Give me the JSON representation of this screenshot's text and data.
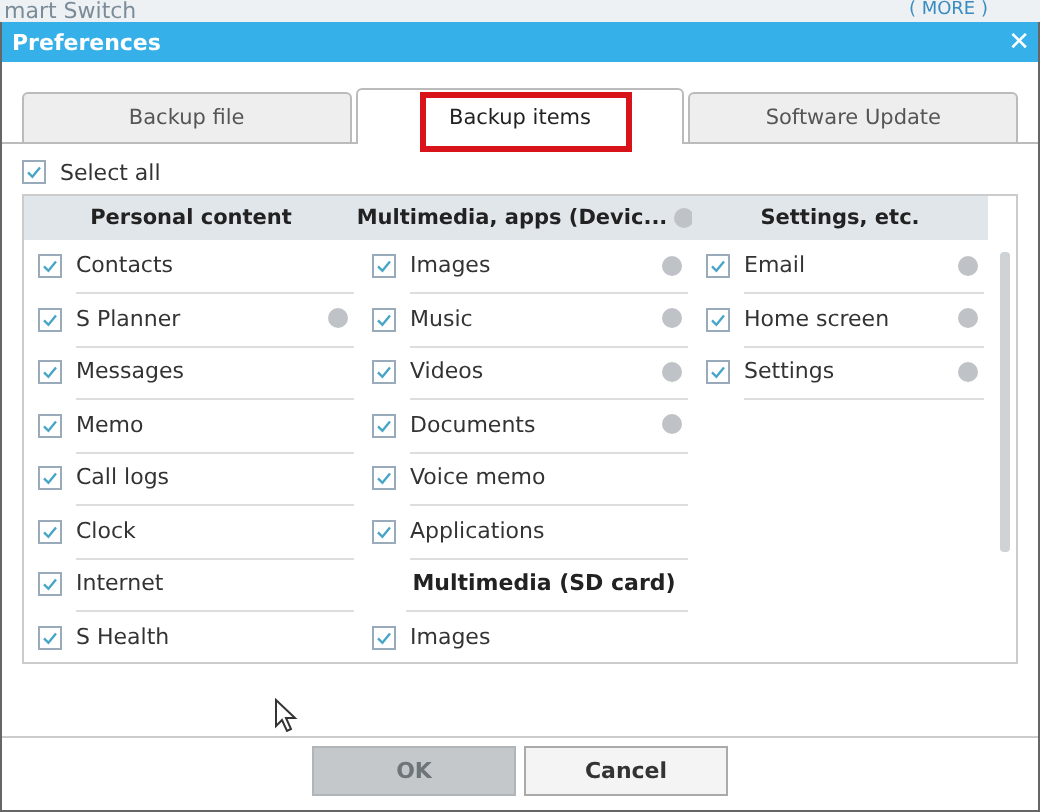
{
  "background_app": {
    "title": "mart Switch",
    "more_button": "( MORE )"
  },
  "window": {
    "title": "Preferences",
    "close": "✕"
  },
  "tabs": [
    {
      "label": "Backup file",
      "selected": false,
      "highlighted": false
    },
    {
      "label": "Backup items",
      "selected": true,
      "highlighted": true
    },
    {
      "label": "Software Update",
      "selected": false,
      "highlighted": false
    }
  ],
  "select_all": {
    "label": "Select all",
    "checked": true
  },
  "columns": [
    {
      "heading": "Personal content",
      "info": false,
      "items": [
        {
          "kind": "item",
          "label": "Contacts",
          "checked": true,
          "info": false
        },
        {
          "kind": "item",
          "label": "S Planner",
          "checked": true,
          "info": true
        },
        {
          "kind": "item",
          "label": "Messages",
          "checked": true,
          "info": false
        },
        {
          "kind": "item",
          "label": "Memo",
          "checked": true,
          "info": false
        },
        {
          "kind": "item",
          "label": "Call logs",
          "checked": true,
          "info": false
        },
        {
          "kind": "item",
          "label": "Clock",
          "checked": true,
          "info": false
        },
        {
          "kind": "item",
          "label": "Internet",
          "checked": true,
          "info": false
        },
        {
          "kind": "item",
          "label": "S Health",
          "checked": true,
          "info": false
        }
      ]
    },
    {
      "heading": "Multimedia, apps (Devic...",
      "info": true,
      "items": [
        {
          "kind": "item",
          "label": "Images",
          "checked": true,
          "info": true
        },
        {
          "kind": "item",
          "label": "Music",
          "checked": true,
          "info": true
        },
        {
          "kind": "item",
          "label": "Videos",
          "checked": true,
          "info": true
        },
        {
          "kind": "item",
          "label": "Documents",
          "checked": true,
          "info": true
        },
        {
          "kind": "item",
          "label": "Voice memo",
          "checked": true,
          "info": false
        },
        {
          "kind": "item",
          "label": "Applications",
          "checked": true,
          "info": false
        },
        {
          "kind": "subheader",
          "label": "Multimedia (SD card)"
        },
        {
          "kind": "item",
          "label": "Images",
          "checked": true,
          "info": false
        }
      ]
    },
    {
      "heading": "Settings, etc.",
      "info": false,
      "items": [
        {
          "kind": "item",
          "label": "Email",
          "checked": true,
          "info": true
        },
        {
          "kind": "item",
          "label": "Home screen",
          "checked": true,
          "info": true
        },
        {
          "kind": "item",
          "label": "Settings",
          "checked": true,
          "info": true
        }
      ]
    }
  ],
  "buttons": [
    {
      "label": "OK",
      "disabled": true
    },
    {
      "label": "Cancel",
      "disabled": false
    }
  ]
}
